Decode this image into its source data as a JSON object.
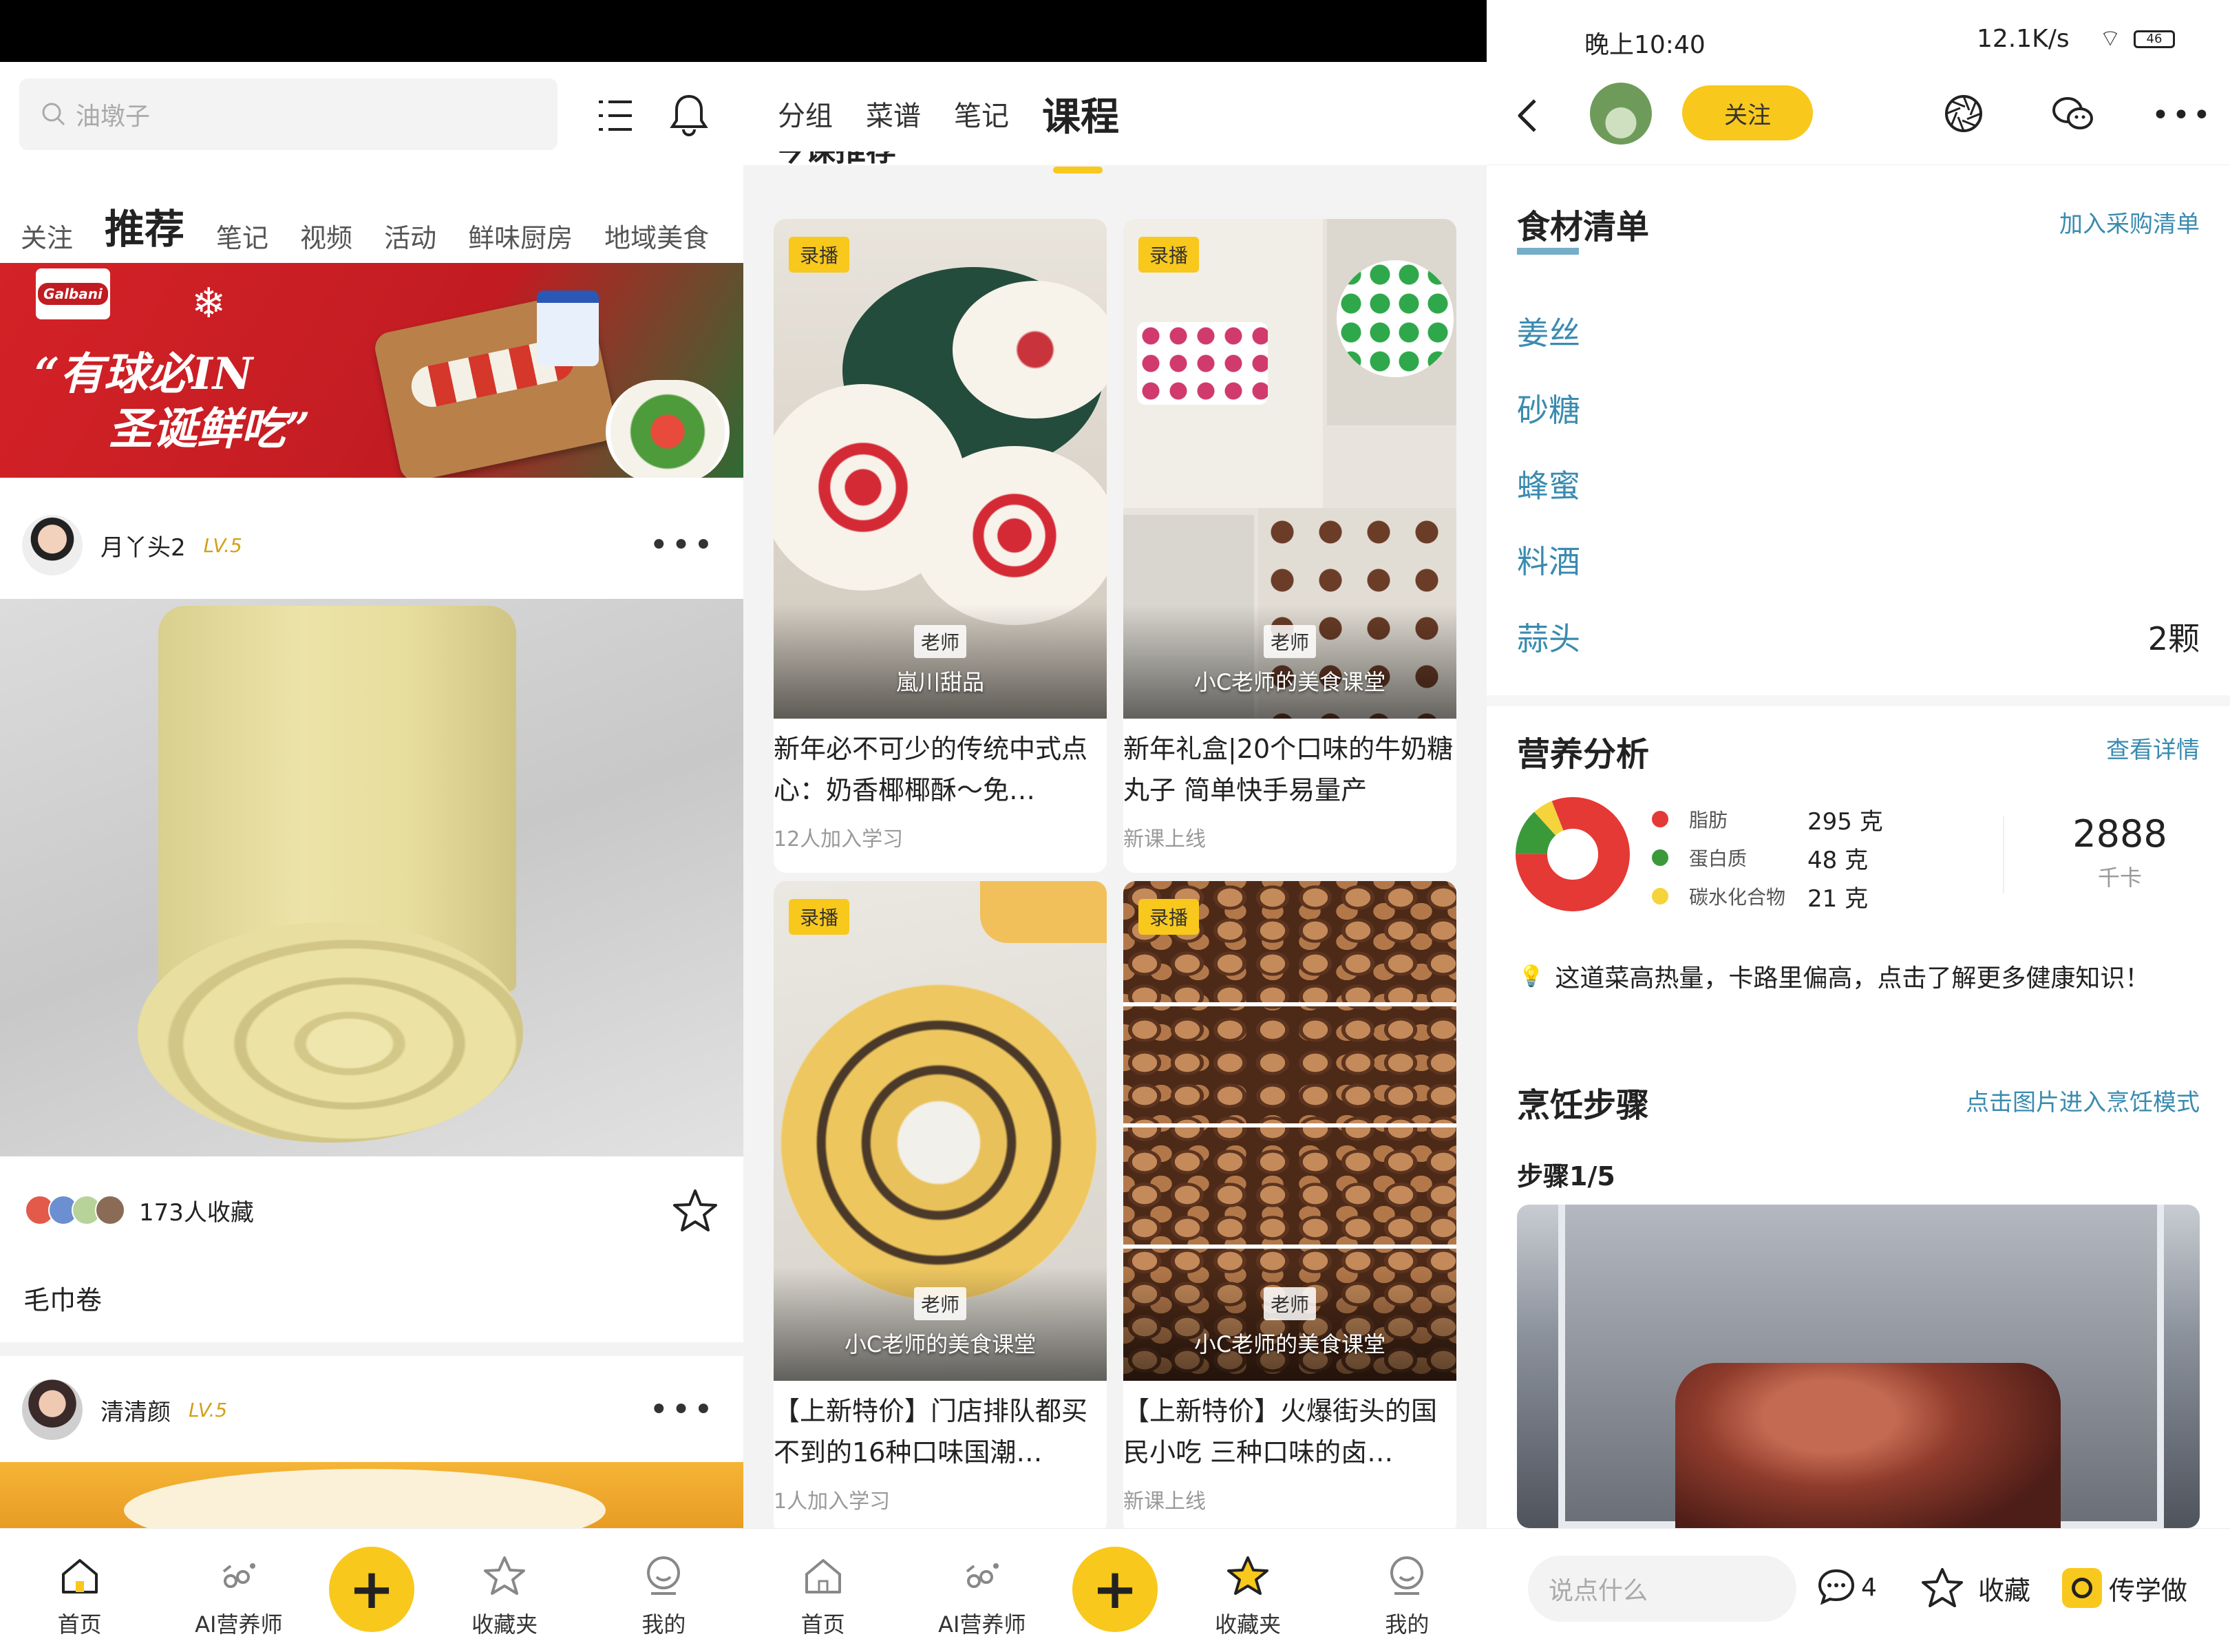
{
  "screen1": {
    "search": {
      "placeholder": "油墩子"
    },
    "tabs": [
      "关注",
      "推荐",
      "笔记",
      "视频",
      "活动",
      "鲜味厨房",
      "地域美食"
    ],
    "banner": {
      "line1": "“有球必IN",
      "line2": "圣诞鲜吃”",
      "brand": "Galbani"
    },
    "posts": [
      {
        "user": "月丫头2",
        "level": "LV.5",
        "favorites": "173人收藏",
        "title": "毛巾卷"
      },
      {
        "user": "清清颜",
        "level": "LV.5"
      }
    ]
  },
  "screen2": {
    "tabs": [
      "分组",
      "菜谱",
      "笔记",
      "课程"
    ],
    "section_heading": "今课推荐",
    "cards": [
      {
        "tag": "录播",
        "teacher_label": "老师",
        "teacher": "嵐川甜品",
        "title": "新年必不可少的传统中式点心：奶香椰椰酥～免…",
        "meta": "12人加入学习"
      },
      {
        "tag": "录播",
        "teacher_label": "老师",
        "teacher": "小C老师的美食课堂",
        "title": "新年礼盒|20个口味的牛奶糖丸子 简单快手易量产",
        "meta": "新课上线"
      },
      {
        "tag": "录播",
        "teacher_label": "老师",
        "teacher": "小C老师的美食课堂",
        "title": "【上新特价】门店排队都买不到的16种口味国潮…",
        "meta": "1人加入学习"
      },
      {
        "tag": "录播",
        "teacher_label": "老师",
        "teacher": "小C老师的美食课堂",
        "title": "【上新特价】火爆街头的国民小吃 三种口味的卤…",
        "meta": "新课上线"
      }
    ]
  },
  "bottom_nav": [
    {
      "label": "首页",
      "icon": "home-icon"
    },
    {
      "label": "AI营养师",
      "icon": "ai-nutritionist-icon"
    },
    {
      "label": "+",
      "icon": "plus-icon"
    },
    {
      "label": "收藏夹",
      "icon": "star-icon"
    },
    {
      "label": "我的",
      "icon": "profile-icon"
    }
  ],
  "screen3": {
    "status": {
      "time": "晚上10:40",
      "net": "12.1K/s",
      "battery": "46"
    },
    "follow_label": "关注",
    "ingredients": {
      "title": "食材清单",
      "link": "加入采购清单",
      "items": [
        {
          "name": "姜丝",
          "amount": ""
        },
        {
          "name": "砂糖",
          "amount": ""
        },
        {
          "name": "蜂蜜",
          "amount": ""
        },
        {
          "name": "料酒",
          "amount": ""
        },
        {
          "name": "蒜头",
          "amount": "2颗"
        }
      ]
    },
    "nutrition": {
      "title": "营养分析",
      "link": "查看详情",
      "items": [
        {
          "name": "脂肪",
          "value": "295 克",
          "color": "#e53935",
          "grams": 295
        },
        {
          "name": "蛋白质",
          "value": "48 克",
          "color": "#3a9a3a",
          "grams": 48
        },
        {
          "name": "碳水化合物",
          "value": "21 克",
          "color": "#f5d33a",
          "grams": 21
        }
      ],
      "calories": "2888",
      "calories_unit": "千卡",
      "tip": "这道菜高热量，卡路里偏高，点击了解更多健康知识！"
    },
    "steps": {
      "title": "烹饪步骤",
      "link": "点击图片进入烹饪模式",
      "step_label": "步骤1/5"
    },
    "bottom": {
      "comment_placeholder": "说点什么",
      "comments": "4",
      "fav_label": "收藏",
      "learn_label": "传学做"
    }
  }
}
